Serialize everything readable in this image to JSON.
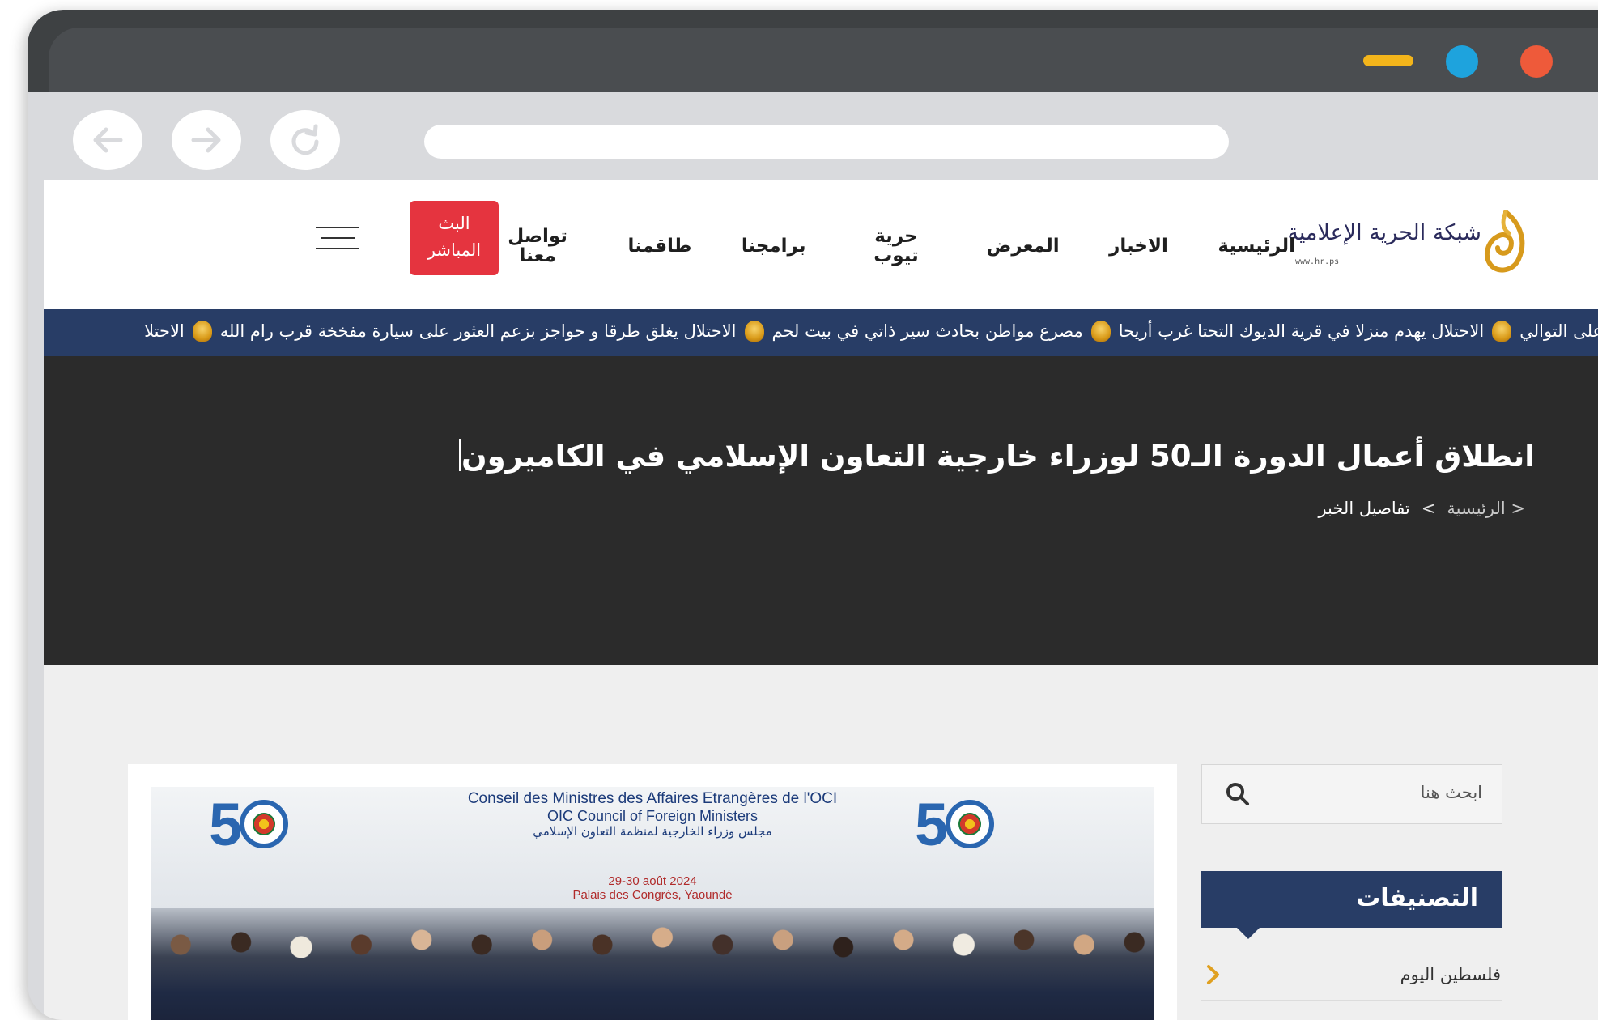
{
  "site": {
    "logo_text": "شبكة الحرية الإعلامية",
    "logo_url": "www.hr.ps"
  },
  "nav": {
    "items": [
      "الرئيسية",
      "الاخبار",
      "المعرض",
      "حرية تيوب",
      "برامجنا",
      "طاقمنا",
      "تواصل معنا"
    ],
    "live_label": "البث المباشر"
  },
  "ticker": {
    "items": [
      "ثالث على التوالي",
      "الاحتلال يهدم منزلا في قرية الديوك التحتا غرب أريحا",
      "مصرع مواطن بحادث سير ذاتي في بيت لحم",
      "الاحتلال يغلق طرقا و حواجز بزعم العثور على سيارة مفخخة قرب رام الله",
      "الاحتلا"
    ]
  },
  "hero": {
    "title": "انطلاق أعمال الدورة الـ50 لوزراء خارجية التعاون الإسلامي في الكاميرون",
    "breadcrumb": {
      "home": "< الرئيسية",
      "sep": ">",
      "current": "تفاصيل الخبر"
    }
  },
  "photo": {
    "banner_fr": "Conseil des Ministres des Affaires Etrangères de l'OCI",
    "banner_en": "OIC Council of Foreign Ministers",
    "banner_ar": "مجلس وزراء الخارجية لمنظمة التعاون الإسلامي",
    "banner_date": "29-30 août 2024",
    "banner_venue": "Palais des Congrès, Yaoundé"
  },
  "sidebar": {
    "search_placeholder": "ابحث هنا",
    "categories_title": "التصنيفات",
    "categories": [
      "فلسطين اليوم"
    ]
  },
  "colors": {
    "nav_blue": "#283d66",
    "live_red": "#e5343f",
    "hero_bg": "#2b2b2b",
    "accent_orange": "#e0a020"
  }
}
